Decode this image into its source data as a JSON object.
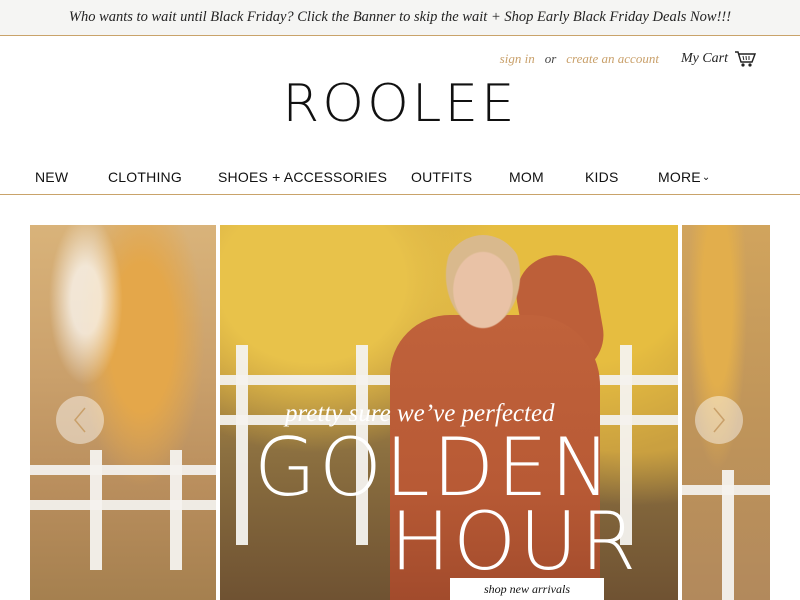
{
  "promo": {
    "text": "Who wants to wait until Black Friday? Click the Banner to skip the wait + Shop Early Black Friday Deals Now!!!"
  },
  "account": {
    "sign_in": "sign in",
    "or": "or",
    "create_account": "create an account",
    "cart_label": "My Cart"
  },
  "logo": {
    "text": "ROOLEE"
  },
  "nav": {
    "items": [
      {
        "label": "NEW"
      },
      {
        "label": "CLOTHING"
      },
      {
        "label": "SHOES + ACCESSORIES"
      },
      {
        "label": "OUTFITS"
      },
      {
        "label": "MOM"
      },
      {
        "label": "KIDS"
      },
      {
        "label": "MORE"
      }
    ]
  },
  "hero": {
    "tagline": "pretty sure we’ve perfected",
    "headline_1": "GOLDEN",
    "headline_2": "HOUR",
    "cta": "shop new arrivals"
  },
  "colors": {
    "accent": "#c9a06a",
    "promo_bg": "#f5f5f3",
    "text": "#111111"
  },
  "icons": {
    "cart": "cart-icon",
    "prev": "chevron-left-icon",
    "next": "chevron-right-icon",
    "more": "chevron-down-icon"
  }
}
